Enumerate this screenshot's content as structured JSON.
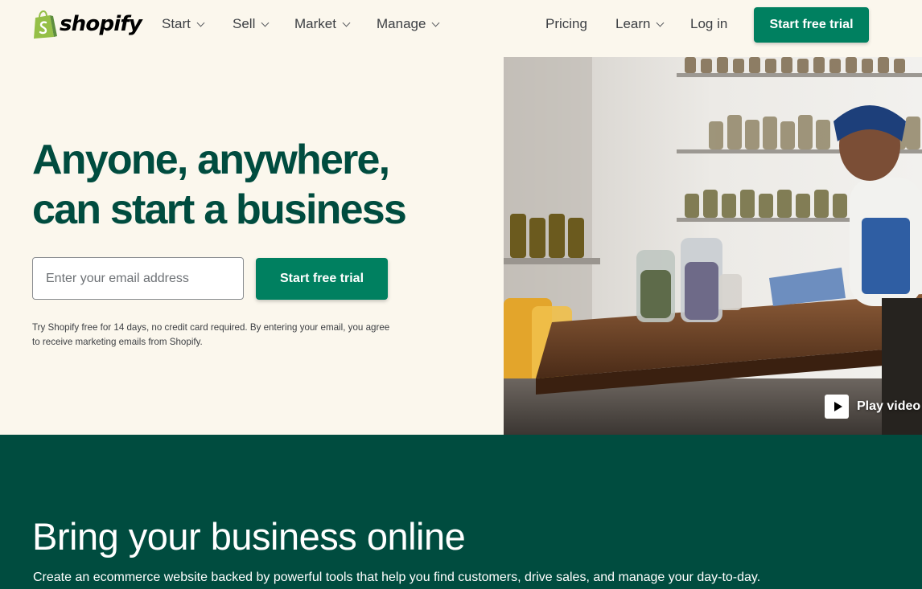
{
  "brand": {
    "name": "shopify",
    "color": "#95bf47"
  },
  "nav": {
    "items": [
      {
        "label": "Start",
        "has_dropdown": true
      },
      {
        "label": "Sell",
        "has_dropdown": true
      },
      {
        "label": "Market",
        "has_dropdown": true
      },
      {
        "label": "Manage",
        "has_dropdown": true
      }
    ],
    "pricing": "Pricing",
    "learn": "Learn",
    "login": "Log in",
    "cta": "Start free trial"
  },
  "hero": {
    "title_line1": "Anyone, anywhere,",
    "title_line2": "can start a business",
    "email_placeholder": "Enter your email address",
    "cta": "Start free trial",
    "disclaimer": "Try Shopify free for 14 days, no credit card required. By entering your email, you agree to receive marketing emails from Shopify.",
    "play_video": "Play video"
  },
  "section": {
    "title": "Bring your business online",
    "subtitle": "Create an ecommerce website backed by powerful tools that help you find customers, drive sales, and manage your day-to-day."
  },
  "colors": {
    "accent": "#008060",
    "dark_green": "#004c3f",
    "background": "#fbf7ed"
  }
}
